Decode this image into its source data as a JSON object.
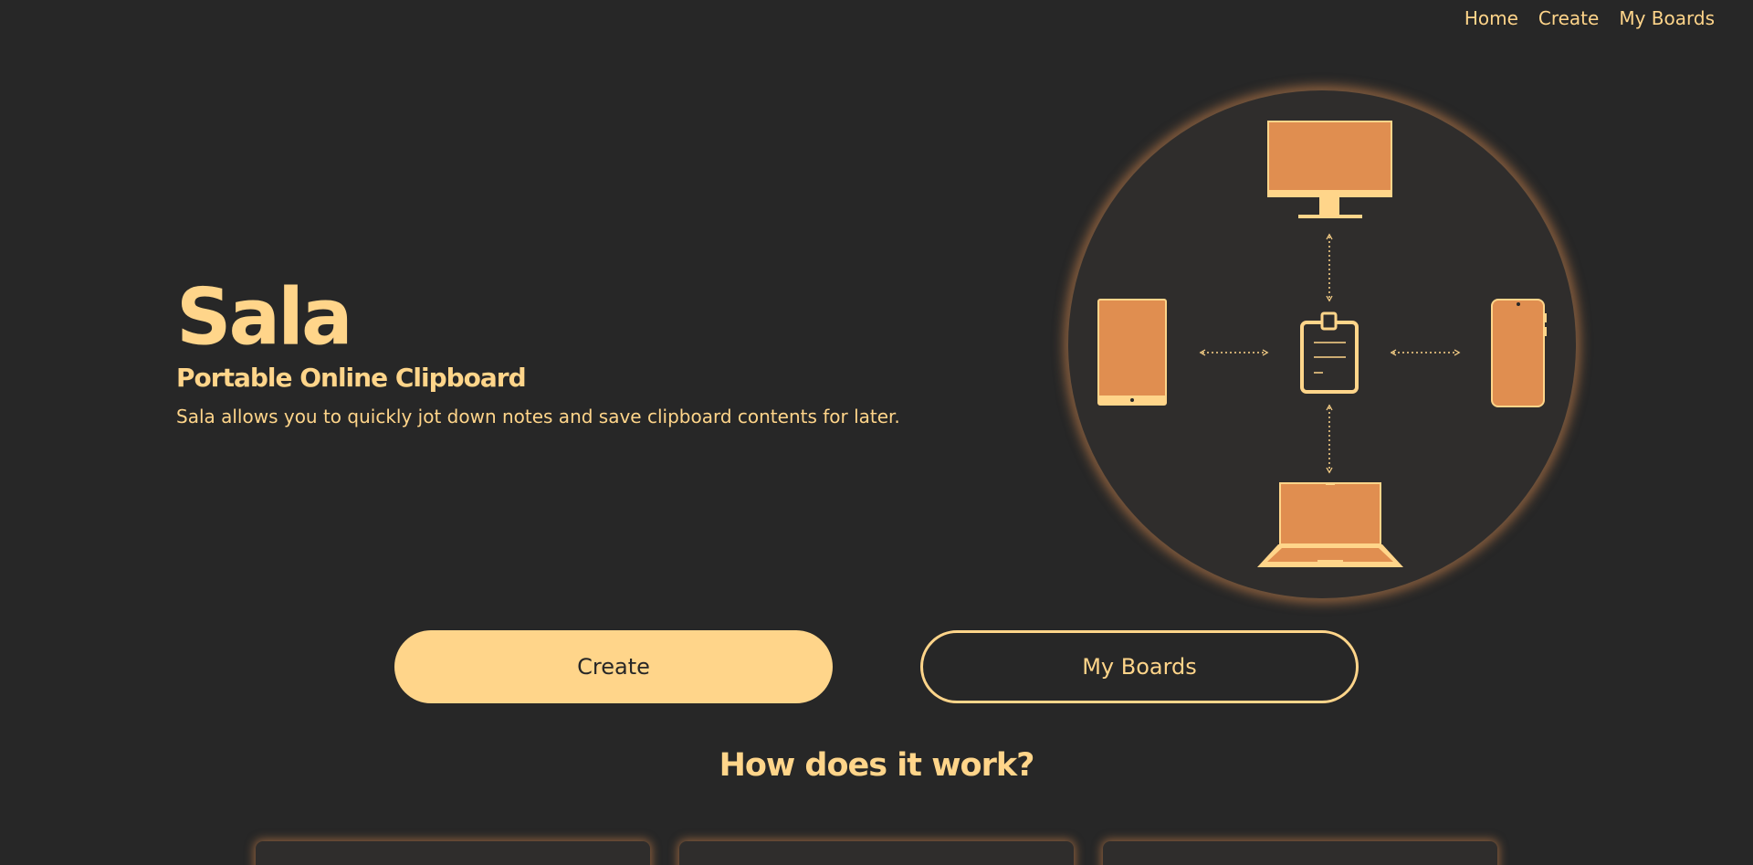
{
  "nav": {
    "items": [
      {
        "label": "Home"
      },
      {
        "label": "Create"
      },
      {
        "label": "My Boards"
      }
    ]
  },
  "hero": {
    "title": "Sala",
    "subtitle": "Portable Online Clipboard",
    "description": "Sala allows you to quickly jot down notes and save clipboard contents for later."
  },
  "illustration": {
    "devices": [
      "monitor-icon",
      "tablet-icon",
      "clipboard-icon",
      "phone-icon",
      "laptop-icon"
    ],
    "colors": {
      "device_fill": "#e08e50",
      "device_outline": "#ffd58a",
      "circle_bg": "#2f2d2c"
    }
  },
  "actions": {
    "create_label": "Create",
    "boards_label": "My Boards"
  },
  "how": {
    "title": "How does it work?"
  },
  "colors": {
    "background": "#272727",
    "accent": "#ffd58a",
    "secondary": "#e08e50"
  }
}
